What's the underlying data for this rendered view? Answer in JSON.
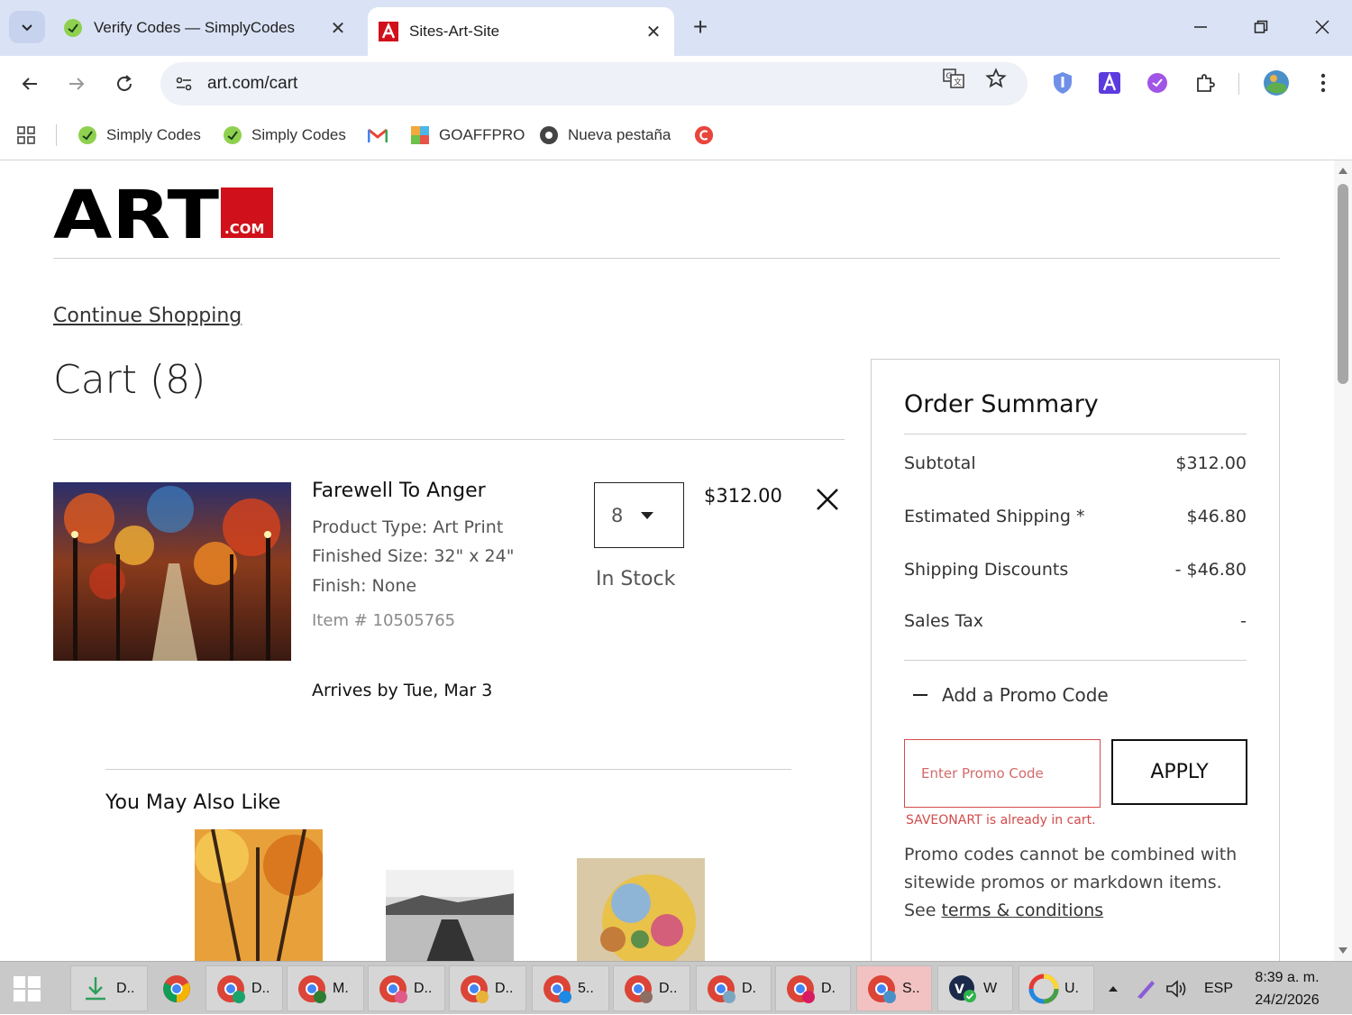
{
  "browser": {
    "tabs": [
      {
        "title": "Verify Codes — SimplyCodes",
        "active": false
      },
      {
        "title": "Sites-Art-Site",
        "active": true
      }
    ],
    "url": "art.com/cart",
    "bookmarks": [
      {
        "label": "Simply Codes",
        "icon": "simplycodes-icon"
      },
      {
        "label": "Simply Codes",
        "icon": "simplycodes-icon"
      },
      {
        "label": "",
        "icon": "gmail-icon"
      },
      {
        "label": "GOAFFPRO",
        "icon": "goaffpro-icon"
      },
      {
        "label": "Nueva pestaña",
        "icon": "chrome-icon"
      },
      {
        "label": "",
        "icon": "red-circle-icon"
      }
    ]
  },
  "page": {
    "logo": {
      "main": "ART",
      "sub": ".COM"
    },
    "continue_shopping": "Continue Shopping",
    "cart_title": "Cart (8)",
    "item": {
      "name": "Farewell To Anger",
      "product_type": "Product Type: Art Print",
      "finished_size": "Finished Size: 32\" x 24\"",
      "finish": "Finish: None",
      "item_number": "Item # 10505765",
      "quantity": "8",
      "price": "$312.00",
      "stock": "In Stock",
      "arrives": "Arrives by Tue, Mar 3"
    },
    "you_may_also_like": "You May Also Like",
    "summary": {
      "title": "Order Summary",
      "rows": [
        {
          "label": "Subtotal",
          "value": "$312.00"
        },
        {
          "label": "Estimated Shipping *",
          "value": "$46.80"
        },
        {
          "label": "Shipping Discounts",
          "value": "- $46.80"
        },
        {
          "label": "Sales Tax",
          "value": "-"
        }
      ],
      "promo_toggle": "Add a Promo Code",
      "promo_placeholder": "Enter Promo Code",
      "apply": "APPLY",
      "promo_error": "SAVEONART is already in cart.",
      "promo_note": "Promo codes cannot be combined with sitewide promos or markdown items. See ",
      "terms_link": "terms & conditions"
    }
  },
  "taskbar": {
    "items": [
      {
        "label": "D..",
        "active": false
      },
      {
        "label": "",
        "active": false
      },
      {
        "label": "D..",
        "active": false
      },
      {
        "label": "M.",
        "active": false
      },
      {
        "label": "D..",
        "active": false
      },
      {
        "label": "D..",
        "active": false
      },
      {
        "label": "5..",
        "active": false
      },
      {
        "label": "D..",
        "active": false
      },
      {
        "label": "D.",
        "active": false
      },
      {
        "label": "D.",
        "active": false
      },
      {
        "label": "S..",
        "active": true
      },
      {
        "label": "W",
        "active": false
      },
      {
        "label": "U.",
        "active": false
      }
    ],
    "language": "ESP",
    "time": "8:39 a. m.",
    "date": "24/2/2026"
  },
  "colors": {
    "accent_red": "#d0111b",
    "error_red": "#d34b4b",
    "tab_strip": "#dae3f5"
  }
}
